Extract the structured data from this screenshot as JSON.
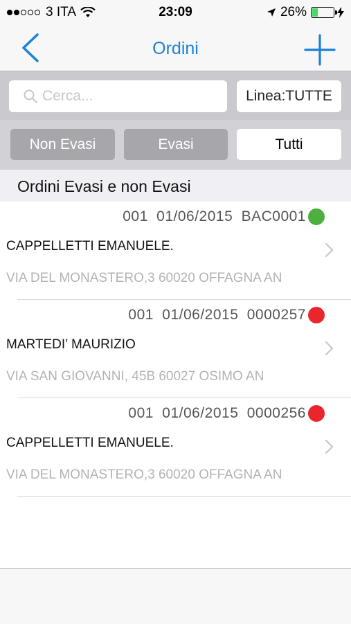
{
  "status": {
    "carrier": "3 ITA",
    "time": "23:09",
    "battery_text": "26%",
    "battery_level": 0.26,
    "signal_bars": 2,
    "signal_total": 5
  },
  "nav": {
    "title": "Ordini",
    "back_icon": "chevron-left-icon",
    "add_icon": "plus-icon"
  },
  "search": {
    "placeholder": "Cerca...",
    "filter_label": "Linea:TUTTE"
  },
  "segments": [
    {
      "label": "Non Evasi",
      "selected": false
    },
    {
      "label": "Evasi",
      "selected": false
    },
    {
      "label": "Tutti",
      "selected": true
    }
  ],
  "section_title": "Ordini Evasi e non Evasi",
  "orders": [
    {
      "code": "001",
      "date": "01/06/2015",
      "number": "BAC0001",
      "status_color": "#4caf3e",
      "customer": "CAPPELLETTI EMANUELE.",
      "address": "VIA DEL MONASTERO,3 60020 OFFAGNA AN"
    },
    {
      "code": "001",
      "date": "01/06/2015",
      "number": "0000257",
      "status_color": "#e8262b",
      "customer": "MARTEDI’ MAURIZIO",
      "address": "VIA SAN GIOVANNI, 45B 60027 OSIMO AN"
    },
    {
      "code": "001",
      "date": "01/06/2015",
      "number": "0000256",
      "status_color": "#e8262b",
      "customer": "CAPPELLETTI EMANUELE.",
      "address": "VIA DEL MONASTERO,3 60020 OFFAGNA AN"
    }
  ],
  "colors": {
    "accent": "#1a82d8",
    "status_done": "#4caf3e",
    "status_pending": "#e8262b"
  }
}
